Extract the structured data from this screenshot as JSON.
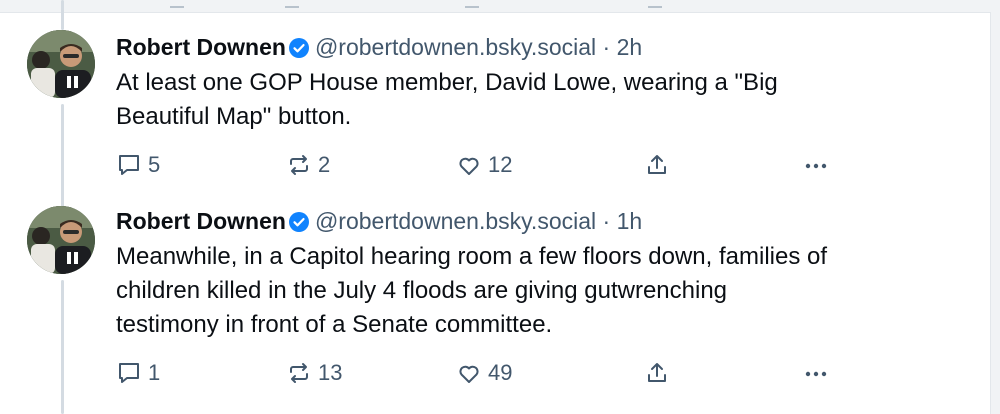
{
  "colors": {
    "accent": "#1083fe",
    "muted_text": "#42576c",
    "thread_line": "#d4dbe2"
  },
  "posts": [
    {
      "author": "Robert Downen",
      "verified_icon": "verified-check-icon",
      "handle": "@robertdownen.bsky.social",
      "separator": "·",
      "time": "2h",
      "text_lines": [
        "At least one GOP House member, David Lowe, wearing a \"Big",
        "Beautiful Map\" button."
      ],
      "reply_count": "5",
      "repost_count": "2",
      "like_count": "12"
    },
    {
      "author": "Robert Downen",
      "verified_icon": "verified-check-icon",
      "handle": "@robertdownen.bsky.social",
      "separator": "·",
      "time": "1h",
      "text_lines": [
        "Meanwhile, in a Capitol hearing room a few floors down, families of",
        "children killed in the July 4 floods are giving gutwrenching",
        "testimony in front of a Senate committee."
      ],
      "reply_count": "1",
      "repost_count": "13",
      "like_count": "49"
    }
  ]
}
